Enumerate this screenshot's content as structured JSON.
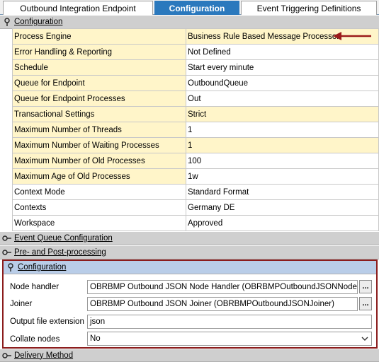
{
  "tabs": [
    {
      "label": "Outbound Integration Endpoint"
    },
    {
      "label": "Configuration"
    },
    {
      "label": "Event Triggering Definitions"
    }
  ],
  "sections": {
    "configuration_main": "Configuration",
    "event_queue": "Event Queue Configuration",
    "pre_post": "Pre- and Post-processing",
    "configuration_sub": "Configuration",
    "delivery": "Delivery Method"
  },
  "properties": [
    {
      "key": "Process Engine",
      "value": "Business Rule Based Message Processor"
    },
    {
      "key": "Error Handling & Reporting",
      "value": "Not Defined"
    },
    {
      "key": "Schedule",
      "value": "Start every minute"
    },
    {
      "key": "Queue for Endpoint",
      "value": "OutboundQueue"
    },
    {
      "key": "Queue for Endpoint Processes",
      "value": "Out"
    },
    {
      "key": "Transactional Settings",
      "value": "Strict"
    },
    {
      "key": "Maximum Number of Threads",
      "value": "1"
    },
    {
      "key": "Maximum Number of Waiting Processes",
      "value": "1"
    },
    {
      "key": "Maximum Number of Old Processes",
      "value": "100"
    },
    {
      "key": "Maximum Age of Old Processes",
      "value": "1w"
    },
    {
      "key": "Context Mode",
      "value": "Standard Format"
    },
    {
      "key": "Contexts",
      "value": "Germany DE"
    },
    {
      "key": "Workspace",
      "value": "Approved"
    }
  ],
  "form": {
    "node_handler_label": "Node handler",
    "node_handler_value": "OBRBMP Outbound JSON Node Handler (OBRBMPOutboundJSONNodeHandler)",
    "joiner_label": "Joiner",
    "joiner_value": "OBRBMP Outbound JSON Joiner (OBRBMPOutboundJSONJoiner)",
    "output_ext_label": "Output file extension",
    "output_ext_value": "json",
    "collate_label": "Collate nodes",
    "collate_value": "No",
    "ellipsis": "..."
  },
  "colors": {
    "active_tab": "#2b79bd",
    "mandatory_cell": "#fff5c9",
    "highlight_box": "#8b1c1c",
    "arrow": "#9b1b1b"
  },
  "icons": {
    "expanded": "pin-icon",
    "collapsed": "expand-icon",
    "ellipsis": "ellipsis-icon",
    "dropdown": "chevron-down-icon"
  }
}
